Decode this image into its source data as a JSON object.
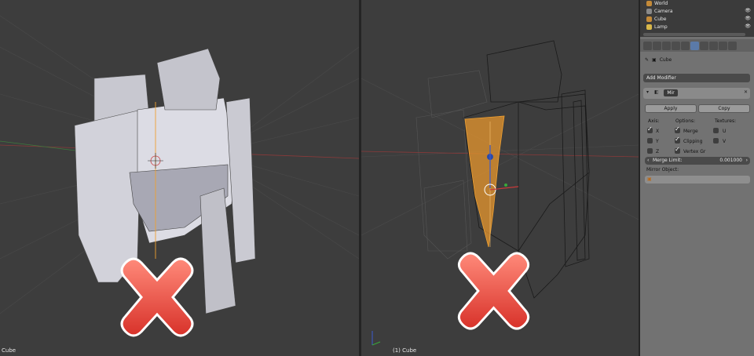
{
  "viewports": {
    "left": {
      "label": "Cube"
    },
    "right": {
      "label": "(1) Cube"
    }
  },
  "outliner": {
    "rows": [
      {
        "name": "World",
        "icon": "world-icon"
      },
      {
        "name": "Camera",
        "icon": "camera-icon"
      },
      {
        "name": "Cube",
        "icon": "mesh-icon"
      },
      {
        "name": "Lamp",
        "icon": "lamp-icon"
      }
    ]
  },
  "properties": {
    "breadcrumb": "Cube",
    "add_modifier": "Add Modifier",
    "modifier_name": "Mir",
    "apply": "Apply",
    "copy": "Copy",
    "axis_header": "Axis:",
    "options_header": "Options:",
    "textures_header": "Textures:",
    "axis": [
      {
        "label": "X",
        "checked": true
      },
      {
        "label": "Y",
        "checked": false
      },
      {
        "label": "Z",
        "checked": false
      }
    ],
    "options": [
      {
        "label": "Merge",
        "checked": true
      },
      {
        "label": "Clipping",
        "checked": true
      },
      {
        "label": "Vertex Gr",
        "checked": true
      }
    ],
    "textures": [
      {
        "label": "U",
        "checked": false
      },
      {
        "label": "V",
        "checked": false
      }
    ],
    "merge_limit_label": "Merge Limit:",
    "merge_limit_value": "0.001000",
    "mirror_object_label": "Mirror Object:"
  },
  "colors": {
    "cross": "#e64a3c",
    "selection": "#f0a030",
    "panel": "#727272"
  }
}
